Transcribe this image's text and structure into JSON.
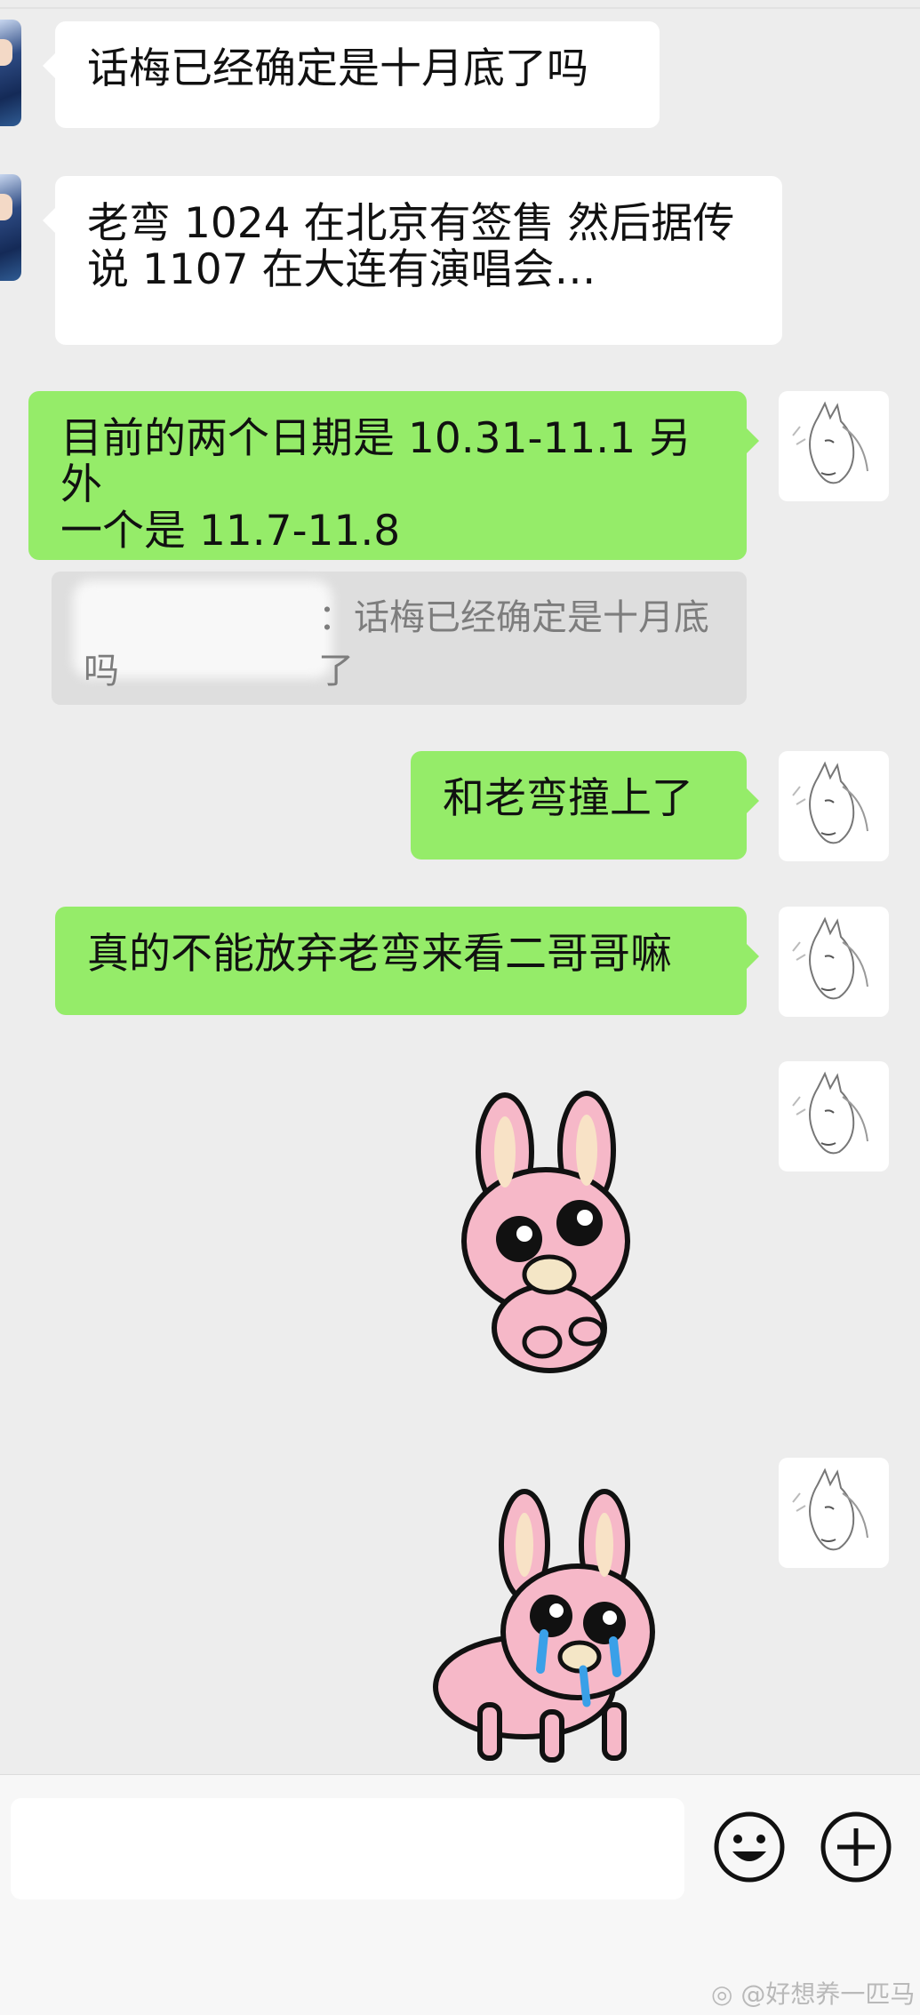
{
  "messages": [
    {
      "side": "left",
      "text": "话梅已经确定是十月底了吗"
    },
    {
      "side": "left",
      "text_line1": "老弯 1024 在北京有签售 然后据传",
      "text_line2": "说 1107 在大连有演唱会…"
    },
    {
      "side": "right",
      "text_line1": "目前的两个日期是 10.31-11.1 另外",
      "text_line2": "一个是 11.7-11.8"
    },
    {
      "side": "right",
      "text": "和老弯撞上了"
    },
    {
      "side": "right",
      "text": "真的不能放弃老弯来看二哥哥嘛"
    }
  ],
  "quote": {
    "text_line1": "：话梅已经确定是十月底了",
    "text_line2": "吗"
  },
  "input": {
    "placeholder": ""
  },
  "watermark": "@好想养一匹马",
  "colors": {
    "background": "#ededed",
    "bubble_right": "#95ec69",
    "bubble_left": "#ffffff",
    "quote_bg": "#dedede"
  },
  "icons": [
    "emoji-icon",
    "plus-icon",
    "horse-avatar",
    "rabbit-sticker",
    "crying-rabbit-sticker",
    "weibo-icon"
  ]
}
